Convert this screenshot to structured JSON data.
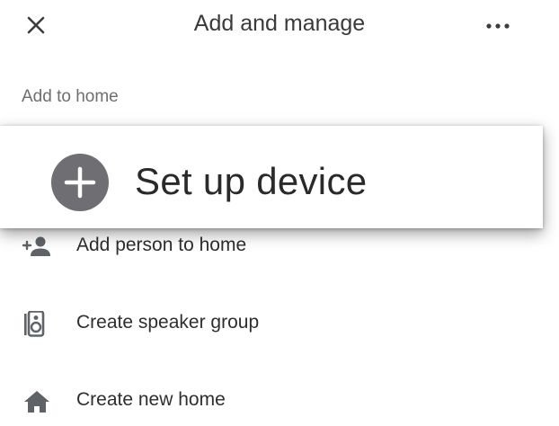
{
  "header": {
    "title": "Add and manage",
    "close_icon": "close-icon",
    "more_icon": "more-horizontal-icon"
  },
  "section": {
    "label": "Add to home"
  },
  "setup": {
    "label": "Set up device",
    "icon": "plus-circle-icon",
    "icon_color": "#6f6f73"
  },
  "items": [
    {
      "label": "Add person to home",
      "icon": "add-person-icon"
    },
    {
      "label": "Create speaker group",
      "icon": "speaker-icon"
    },
    {
      "label": "Create new home",
      "icon": "home-icon"
    }
  ],
  "colors": {
    "icon_gray": "#5f6368",
    "text": "#2e2e2e",
    "section_text": "#6e6e6e"
  }
}
